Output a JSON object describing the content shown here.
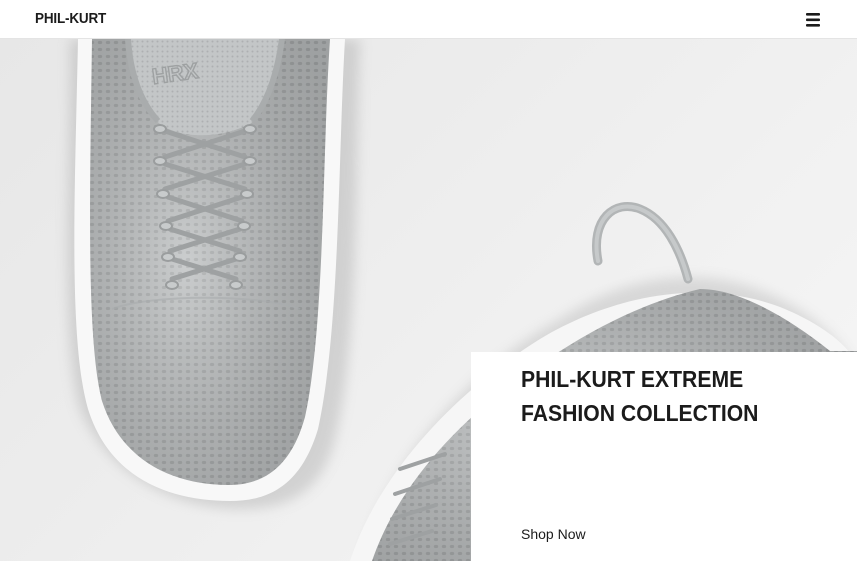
{
  "header": {
    "logo_text": "PHIL-KURT",
    "menu_icon": "hamburger-menu-icon"
  },
  "hero": {
    "image_description_icon": "sneaker-hero-image",
    "shoe_logo_text": "HRX"
  },
  "promo": {
    "title": "PHIL-KURT EXTREME FASHION COLLECTION",
    "cta_label": "Shop Now"
  },
  "colors": {
    "text": "#1b1b1b",
    "shoe_knit": "#b9bcbd",
    "sole": "#ffffff",
    "background": "#ececec"
  }
}
